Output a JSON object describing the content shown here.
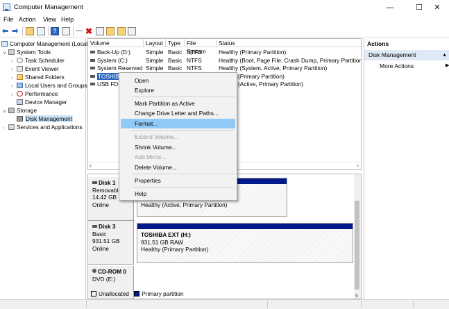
{
  "window": {
    "title": "Computer Management",
    "controls": [
      "—",
      "☐",
      "✕"
    ]
  },
  "menu": [
    "File",
    "Action",
    "View",
    "Help"
  ],
  "tree": {
    "root": "Computer Management (Local",
    "system_tools": "System Tools",
    "items": [
      "Task Scheduler",
      "Event Viewer",
      "Shared Folders",
      "Local Users and Groups",
      "Performance",
      "Device Manager"
    ],
    "storage": "Storage",
    "disk_management": "Disk Management",
    "services": "Services and Applications"
  },
  "volume_list": {
    "columns": [
      "Volume",
      "Layout",
      "Type",
      "File System",
      "Status"
    ],
    "rows": [
      [
        "Back-Up (D:)",
        "Simple",
        "Basic",
        "NTFS",
        "Healthy (Primary Partition)"
      ],
      [
        "System (C:)",
        "Simple",
        "Basic",
        "NTFS",
        "Healthy (Boot, Page File, Crash Dump, Primary Partition)"
      ],
      [
        "System Reserved",
        "Simple",
        "Basic",
        "NTFS",
        "Healthy (System, Active, Primary Partition)"
      ],
      [
        "TOSHIBA",
        "",
        "",
        "",
        "(Primary Partition)"
      ],
      [
        "USB FD (",
        "",
        "",
        "",
        "(Active, Primary Partition)"
      ]
    ]
  },
  "disks": [
    {
      "name": "Disk 1",
      "type": "Removable",
      "size": "14.42 GB",
      "state": "Online",
      "partition_status": "Healthy (Active, Primary Partition)"
    },
    {
      "name": "Disk 3",
      "type": "Basic",
      "size": "931.51 GB",
      "state": "Online",
      "partition_name": "TOSHIBA EXT  (H:)",
      "partition_size": "931.51 GB RAW",
      "partition_status": "Healthy (Primary Partition)"
    },
    {
      "name": "CD-ROM 0",
      "type": "DVD (E:)"
    }
  ],
  "legend": {
    "unallocated": "Unallocated",
    "primary": "Primary partition",
    "unallocated_color": "#000000",
    "primary_color": "#001a8c"
  },
  "actions": {
    "header": "Actions",
    "section": "Disk Management",
    "more": "More Actions"
  },
  "context_menu": {
    "items": [
      "Open",
      "Explore",
      "Mark Partition as Active",
      "Change Drive Letter and Paths...",
      "Format...",
      "Extend Volume...",
      "Shrink Volume...",
      "Add Mirror...",
      "Delete Volume...",
      "Properties",
      "Help"
    ],
    "highlighted": "Format...",
    "disabled": [
      "Extend Volume...",
      "Add Mirror..."
    ]
  },
  "colors": {
    "accent": "#2a67c1",
    "selection": "#cce4f7",
    "menu_hover": "#91c9f7"
  }
}
